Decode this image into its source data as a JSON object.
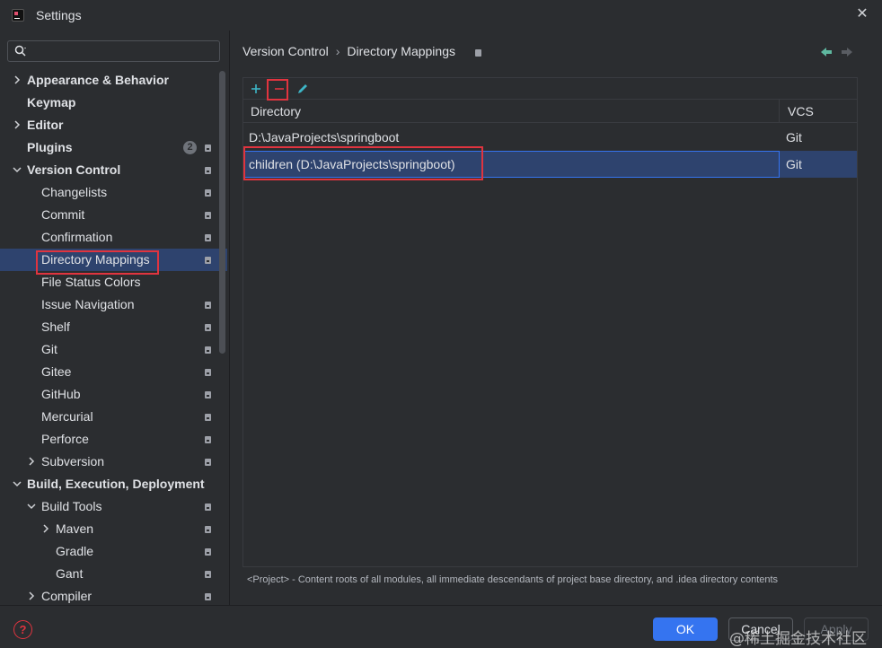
{
  "window": {
    "title": "Settings",
    "close_glyph": "✕"
  },
  "search": {
    "placeholder": ""
  },
  "sidebar": {
    "items": [
      {
        "label": "Appearance & Behavior",
        "level": 0,
        "bold": true,
        "chevron": "right"
      },
      {
        "label": "Keymap",
        "level": 0,
        "bold": true,
        "chevron": "none"
      },
      {
        "label": "Editor",
        "level": 0,
        "bold": true,
        "chevron": "right"
      },
      {
        "label": "Plugins",
        "level": 0,
        "bold": true,
        "chevron": "none",
        "badge": "2",
        "page_icon": true
      },
      {
        "label": "Version Control",
        "level": 0,
        "bold": true,
        "chevron": "down",
        "page_icon": true
      },
      {
        "label": "Changelists",
        "level": 1,
        "chevron": "none",
        "page_icon": true
      },
      {
        "label": "Commit",
        "level": 1,
        "chevron": "none",
        "page_icon": true
      },
      {
        "label": "Confirmation",
        "level": 1,
        "chevron": "none",
        "page_icon": true
      },
      {
        "label": "Directory Mappings",
        "level": 1,
        "chevron": "none",
        "page_icon": true,
        "selected": true
      },
      {
        "label": "File Status Colors",
        "level": 1,
        "chevron": "none"
      },
      {
        "label": "Issue Navigation",
        "level": 1,
        "chevron": "none",
        "page_icon": true
      },
      {
        "label": "Shelf",
        "level": 1,
        "chevron": "none",
        "page_icon": true
      },
      {
        "label": "Git",
        "level": 1,
        "chevron": "none",
        "page_icon": true
      },
      {
        "label": "Gitee",
        "level": 1,
        "chevron": "none",
        "page_icon": true
      },
      {
        "label": "GitHub",
        "level": 1,
        "chevron": "none",
        "page_icon": true
      },
      {
        "label": "Mercurial",
        "level": 1,
        "chevron": "none",
        "page_icon": true
      },
      {
        "label": "Perforce",
        "level": 1,
        "chevron": "none",
        "page_icon": true
      },
      {
        "label": "Subversion",
        "level": 1,
        "chevron": "right",
        "page_icon": true
      },
      {
        "label": "Build, Execution, Deployment",
        "level": 0,
        "bold": true,
        "chevron": "down"
      },
      {
        "label": "Build Tools",
        "level": 1,
        "chevron": "down",
        "page_icon": true
      },
      {
        "label": "Maven",
        "level": 2,
        "chevron": "right",
        "page_icon": true
      },
      {
        "label": "Gradle",
        "level": 2,
        "chevron": "none",
        "page_icon": true
      },
      {
        "label": "Gant",
        "level": 2,
        "chevron": "none",
        "page_icon": true
      },
      {
        "label": "Compiler",
        "level": 1,
        "chevron": "right",
        "page_icon": true
      }
    ]
  },
  "breadcrumb": {
    "parent": "Version Control",
    "separator": "›",
    "current": "Directory Mappings"
  },
  "toolbar": {
    "add_icon": "plus-icon",
    "remove_icon": "minus-icon",
    "edit_icon": "pencil-icon"
  },
  "table": {
    "columns": [
      "Directory",
      "VCS"
    ],
    "rows": [
      {
        "directory": "D:\\JavaProjects\\springboot",
        "vcs": "Git",
        "selected": false
      },
      {
        "directory": "children (D:\\JavaProjects\\springboot)",
        "vcs": "Git",
        "selected": true
      }
    ]
  },
  "footnote": "<Project> - Content roots of all modules, all immediate descendants of project base directory, and .idea directory contents",
  "buttons": {
    "ok": "OK",
    "cancel": "Cancel",
    "apply": "Apply",
    "help": "?"
  },
  "watermark": "@稀土掘金技术社区",
  "colors": {
    "accent": "#3574f0",
    "selection": "#2e436e",
    "highlight_box": "#e0343f",
    "background": "#2b2d30"
  }
}
